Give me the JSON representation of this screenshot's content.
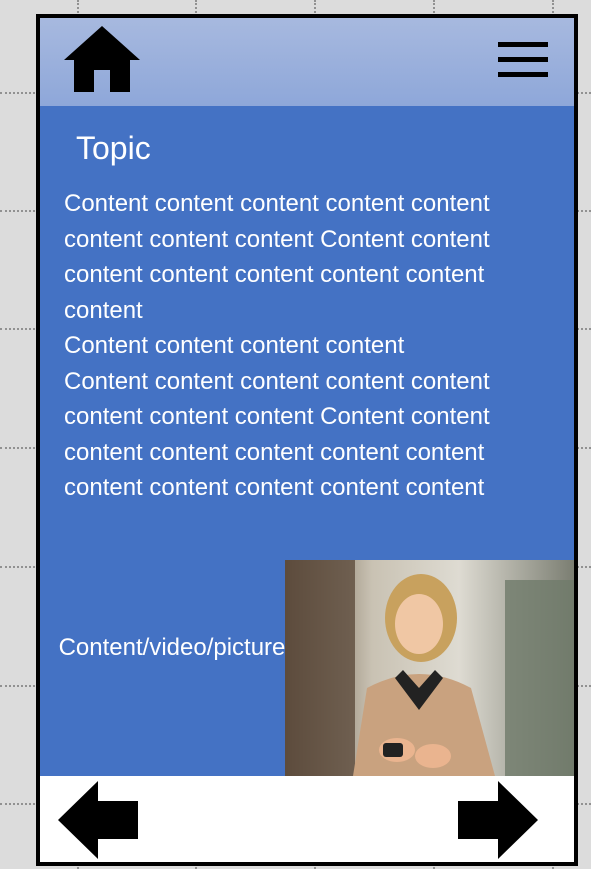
{
  "header": {
    "home_icon": "home-icon",
    "menu_icon": "hamburger-menu-icon"
  },
  "main": {
    "topic": "Topic",
    "paragraphs": [
      "Content content content content content content content content Content content content content content content content content",
      "Content content content content",
      "Content content content content content content content content Content content content content content content content content content content content content"
    ],
    "media_label": "Content/video/picture"
  },
  "footer": {
    "back_icon": "left-arrow-icon",
    "next_icon": "right-arrow-icon"
  },
  "colors": {
    "background": "#dcdcdc",
    "panel": "#4472c4",
    "header": "#9db1de",
    "text": "#ffffff",
    "footer": "#ffffff"
  }
}
